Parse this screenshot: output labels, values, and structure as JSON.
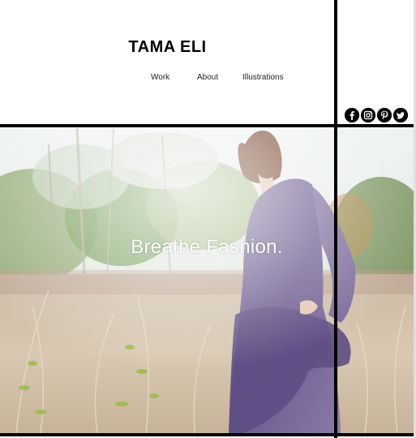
{
  "header": {
    "title": "TAMA ELI"
  },
  "nav": {
    "items": [
      {
        "label": "Work"
      },
      {
        "label": "About"
      },
      {
        "label": "Illustrations"
      }
    ]
  },
  "hero": {
    "tagline": "Breathe Fashion."
  },
  "social": {
    "icons": [
      "facebook-icon",
      "instagram-icon",
      "pinterest-icon",
      "twitter-icon"
    ]
  },
  "colors": {
    "background": "#ffffff",
    "lines": "#000000",
    "text": "#000000",
    "tagline": "#ffffff"
  }
}
